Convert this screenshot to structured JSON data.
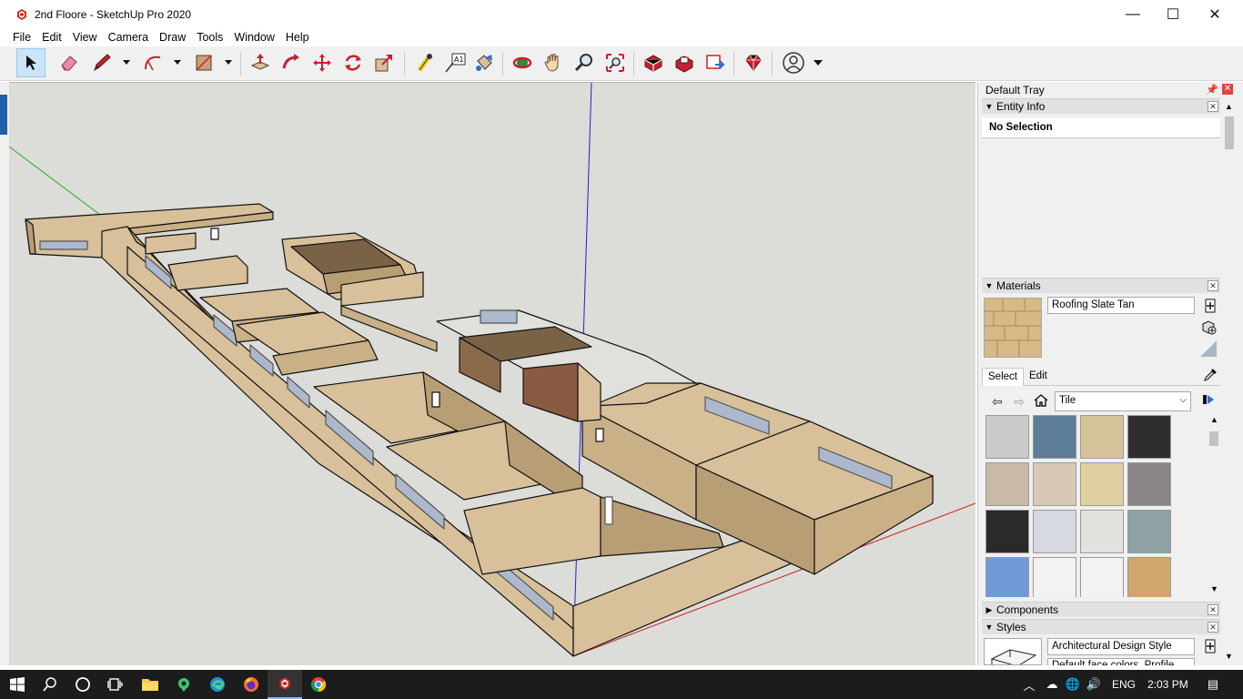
{
  "window": {
    "title": "2nd Floore - SketchUp Pro 2020",
    "minimize": "—",
    "maximize": "☐",
    "close": "✕"
  },
  "menu": [
    "File",
    "Edit",
    "View",
    "Camera",
    "Draw",
    "Tools",
    "Window",
    "Help"
  ],
  "toolbar": {
    "tools": [
      "select-icon",
      "eraser-icon",
      "pencil-line-icon",
      "arc-icon",
      "rectangle-shape-icon",
      "push-pull-icon",
      "follow-me-icon",
      "move-icon",
      "rotate-icon",
      "offset-scale-icon",
      "tape-measure-icon",
      "text-label-icon",
      "paint-bucket-icon",
      "orbit-icon",
      "pan-icon",
      "zoom-icon",
      "zoom-extents-icon",
      "3d-warehouse-icon",
      "extension-warehouse-icon",
      "layout-send-icon",
      "ruby-extension-icon",
      "account-icon"
    ],
    "text_label_glyph": "A1"
  },
  "tray": {
    "title": "Default Tray",
    "entity_info": {
      "label": "Entity Info",
      "selection": "No Selection"
    },
    "materials": {
      "label": "Materials",
      "current_material": "Roofing Slate Tan",
      "tab_select": "Select",
      "tab_edit": "Edit",
      "library": "Tile",
      "swatch_colors": [
        "#c9cbc8",
        "#5e7d96",
        "#d7c39a",
        "#2e2e2e",
        "#c9b9a6",
        "#d8c9b4",
        "#e0cf9f",
        "#8a8585",
        "#2a2a2a",
        "#d7d9e0",
        "#e3e1de",
        "#8fa3a6",
        "#6f9ad6",
        "#f2f2f2",
        "#f2f2f2",
        "#cfa66c"
      ]
    },
    "components": {
      "label": "Components"
    },
    "styles": {
      "label": "Styles",
      "style_name": "Architectural Design Style",
      "style_desc": "Default face colors. Profile"
    }
  },
  "taskbar": {
    "apps": [
      "windows-start-icon",
      "search-icon",
      "cortana-icon",
      "task-view-icon",
      "file-explorer-icon",
      "maps-icon",
      "edge-icon",
      "firefox-icon",
      "sketchup-icon",
      "chrome-icon"
    ],
    "language": "ENG",
    "time": "2:03 PM"
  },
  "colors": {
    "viewport_bg": "#dcdcd8",
    "wall_face": "#d8c09a",
    "wall_shade": "#b89e74",
    "axis_red": "#cc2222",
    "axis_green": "#22aa22",
    "axis_blue": "#2222cc",
    "window_glass": "#aeb8cc",
    "selection_blue": "#cce4f7"
  }
}
